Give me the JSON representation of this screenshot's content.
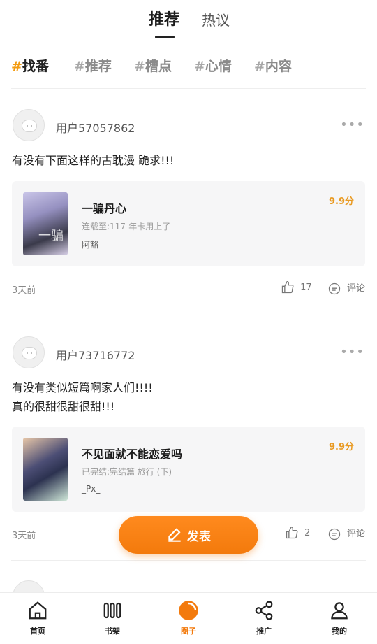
{
  "top_tabs": [
    {
      "label": "推荐",
      "active": true
    },
    {
      "label": "热议",
      "active": false
    }
  ],
  "tags": [
    {
      "hash": "#",
      "label": "找番",
      "active": true
    },
    {
      "hash": "#",
      "label": "推荐",
      "active": false
    },
    {
      "hash": "#",
      "label": "槽点",
      "active": false
    },
    {
      "hash": "#",
      "label": "心情",
      "active": false
    },
    {
      "hash": "#",
      "label": "内容",
      "active": false
    }
  ],
  "posts": [
    {
      "username": "用户57057862",
      "more": "•••",
      "text_lines": [
        "有没有下面这样的古耽漫 跪求!!!"
      ],
      "book": {
        "title": "一骗丹心",
        "status": "连载至:117-年卡用上了-",
        "author": "阿豁",
        "score": "9.9分",
        "cover_deco": "一骗"
      },
      "time": "3天前",
      "likes": "17",
      "comment_label": "评论"
    },
    {
      "username": "用户73716772",
      "more": "•••",
      "text_lines": [
        "有没有类似短篇啊家人们!!!!",
        "真的很甜很甜很甜!!!"
      ],
      "book": {
        "title": "不见面就不能恋爱吗",
        "status": "已完结:完结篇 旅行 (下)",
        "author": "_Px_",
        "score": "9.9分",
        "cover_deco": ""
      },
      "time": "3天前",
      "likes": "2",
      "comment_label": "评论"
    }
  ],
  "fab": {
    "label": "发表",
    "icon": "pen-icon"
  },
  "bottom_nav": [
    {
      "label": "首页",
      "icon": "home-icon",
      "active": false
    },
    {
      "label": "书架",
      "icon": "bookshelf-icon",
      "active": false
    },
    {
      "label": "圈子",
      "icon": "circle-icon",
      "active": true
    },
    {
      "label": "推广",
      "icon": "share-icon",
      "active": false
    },
    {
      "label": "我的",
      "icon": "user-icon",
      "active": false
    }
  ],
  "colors": {
    "accent": "#f37a0c",
    "score": "#e99a22"
  }
}
